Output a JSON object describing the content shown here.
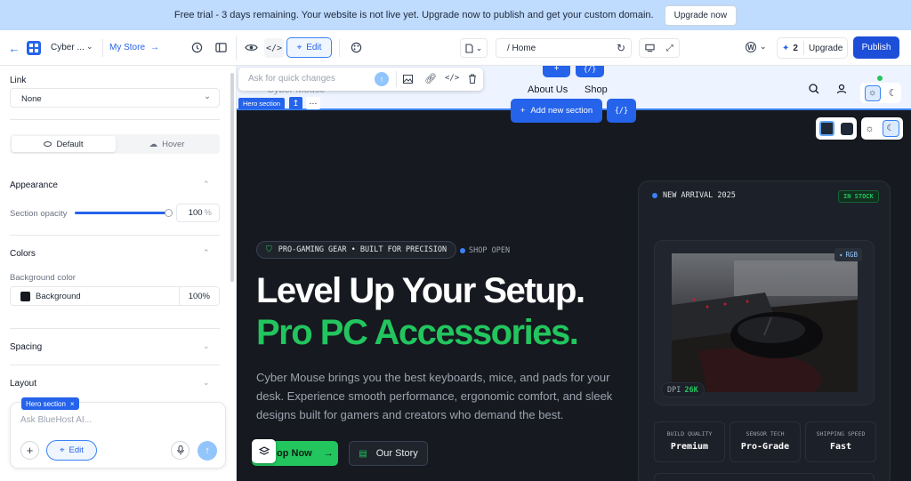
{
  "banner": {
    "text": "Free trial - 3 days remaining. Your website is not live yet. Upgrade now to publish and get your custom domain.",
    "button": "Upgrade now"
  },
  "topbar": {
    "site_name": "Cyber ...",
    "store_link": "My Store",
    "edit_label": "Edit",
    "url": "/ Home",
    "credits": "2",
    "upgrade": "Upgrade",
    "publish": "Publish"
  },
  "sidebar": {
    "link_label": "Link",
    "link_value": "None",
    "state_default": "Default",
    "state_hover": "Hover",
    "appearance": "Appearance",
    "opacity_label": "Section opacity",
    "opacity_value": "100",
    "opacity_unit": "%",
    "opacity_fraction": 1.0,
    "colors": "Colors",
    "bg_label": "Background color",
    "bg_name": "Background",
    "bg_pct": "100%",
    "spacing": "Spacing",
    "layout": "Layout",
    "chat_tag": "Hero section",
    "chat_placeholder": "Ask BlueHost AI...",
    "chat_edit": "Edit"
  },
  "toolbar": {
    "quick_placeholder": "Ask for quick changes",
    "section_tag": "Hero section",
    "add_section": "Add new section"
  },
  "site": {
    "nav_partial": "Cyber Mouse",
    "nav_about": "About Us",
    "nav_shop": "Shop",
    "badge": "PRO-GAMING GEAR • BUILT FOR PRECISION",
    "shop_status": "SHOP OPEN",
    "headline1": "Level Up Your Setup.",
    "headline2": "Pro PC Accessories.",
    "body": "Cyber Mouse brings you the best keyboards, mice, and pads for your desk. Experience smooth performance, ergonomic comfort, and sleek designs built for gamers and creators who demand the best.",
    "cta_primary": "op Now",
    "cta_secondary": "Our Story",
    "card_tag": "NEW ARRIVAL 2025",
    "stock": "IN STOCK",
    "rgb": "RGB",
    "dpi_label": "DPI",
    "dpi_value": "26K",
    "stats": [
      {
        "label": "BUILD QUALITY",
        "value": "Premium"
      },
      {
        "label": "SENSOR TECH",
        "value": "Pro-Grade"
      },
      {
        "label": "SHIPPING SPEED",
        "value": "Fast"
      }
    ]
  },
  "colors": {
    "accent": "#2563eb",
    "green": "#22c55e",
    "dark": "#16191f"
  }
}
